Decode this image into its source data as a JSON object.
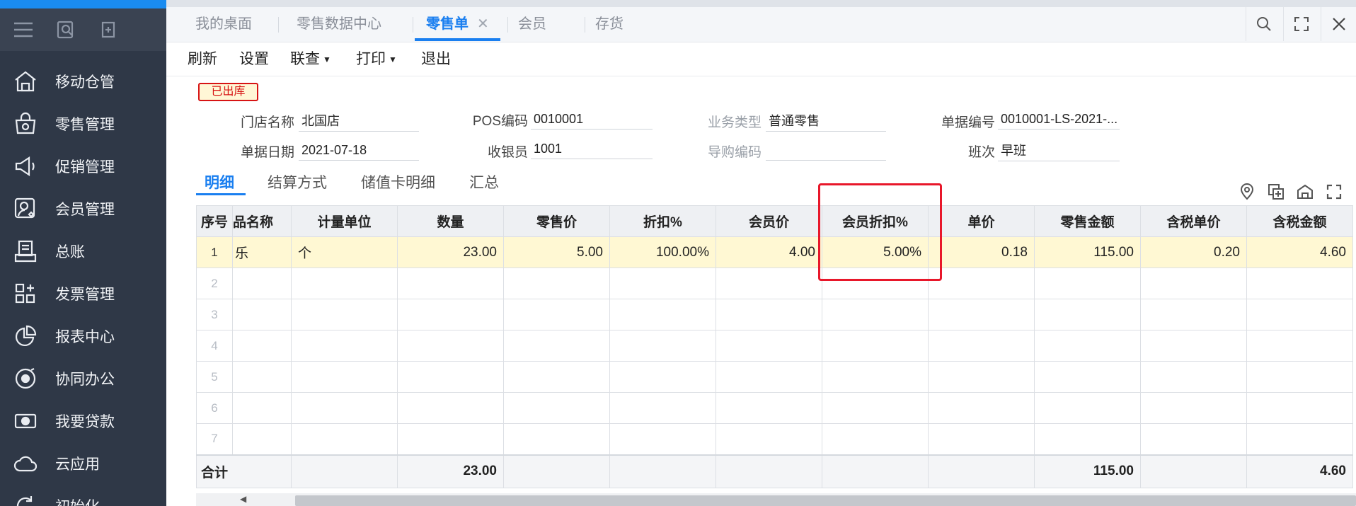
{
  "sidebar": {
    "quick_icons": [
      "menu-icon",
      "search-doc-icon",
      "add-doc-icon"
    ],
    "items": [
      {
        "label": "移动仓管",
        "icon": "warehouse-icon"
      },
      {
        "label": "零售管理",
        "icon": "shop-icon"
      },
      {
        "label": "促销管理",
        "icon": "megaphone-icon"
      },
      {
        "label": "会员管理",
        "icon": "member-icon"
      },
      {
        "label": "总账",
        "icon": "ledger-icon"
      },
      {
        "label": "发票管理",
        "icon": "invoice-icon"
      },
      {
        "label": "报表中心",
        "icon": "pie-chart-icon"
      },
      {
        "label": "协同办公",
        "icon": "collab-icon"
      },
      {
        "label": "我要贷款",
        "icon": "money-icon"
      },
      {
        "label": "云应用",
        "icon": "cloud-icon"
      },
      {
        "label": "初始化",
        "icon": "reset-icon"
      }
    ]
  },
  "tabs": [
    {
      "label": "我的桌面"
    },
    {
      "label": "零售数据中心"
    },
    {
      "label": "零售单",
      "active": true,
      "close": "✕"
    },
    {
      "label": "会员"
    },
    {
      "label": "存货"
    }
  ],
  "toolbar": {
    "refresh": "刷新",
    "settings": "设置",
    "query": "联查",
    "print": "打印",
    "exit": "退出"
  },
  "status_badge": "已出库",
  "form": {
    "store_label": "门店名称",
    "store_value": "北国店",
    "pos_label": "POS编码",
    "pos_value": "0010001",
    "biztype_label": "业务类型",
    "biztype_value": "普通零售",
    "docno_label": "单据编号",
    "docno_value": "0010001-LS-2021-...",
    "date_label": "单据日期",
    "date_value": "2021-07-18",
    "cashier_label": "收银员",
    "cashier_value": "1001",
    "guide_label": "导购编码",
    "guide_value": "",
    "shift_label": "班次",
    "shift_value": "早班"
  },
  "subtabs": [
    "明细",
    "结算方式",
    "储值卡明细",
    "汇总"
  ],
  "grid": {
    "headers": [
      "序号",
      "品名称",
      "计量单位",
      "数量",
      "零售价",
      "折扣%",
      "会员价",
      "会员折扣%",
      "单价",
      "零售金额",
      "含税单价",
      "含税金额"
    ],
    "rows": [
      {
        "idx": "1",
        "name": "乐",
        "unit": "个",
        "qty": "23.00",
        "price": "5.00",
        "discount": "100.00%",
        "member_price": "4.00",
        "member_discount": "5.00%",
        "unit_price": "0.18",
        "amount": "115.00",
        "tax_unit_price": "0.20",
        "tax_amount": "4.60"
      }
    ],
    "empty_rows": [
      "2",
      "3",
      "4",
      "5",
      "6",
      "7"
    ],
    "total": {
      "label": "合计",
      "qty": "23.00",
      "amount": "115.00",
      "tax_amount": "4.60"
    }
  },
  "colors": {
    "accent": "#1a7ff0",
    "sidebar": "#2f3847",
    "highlight_box": "#e8172a",
    "row_highlight": "#fff8d3"
  }
}
